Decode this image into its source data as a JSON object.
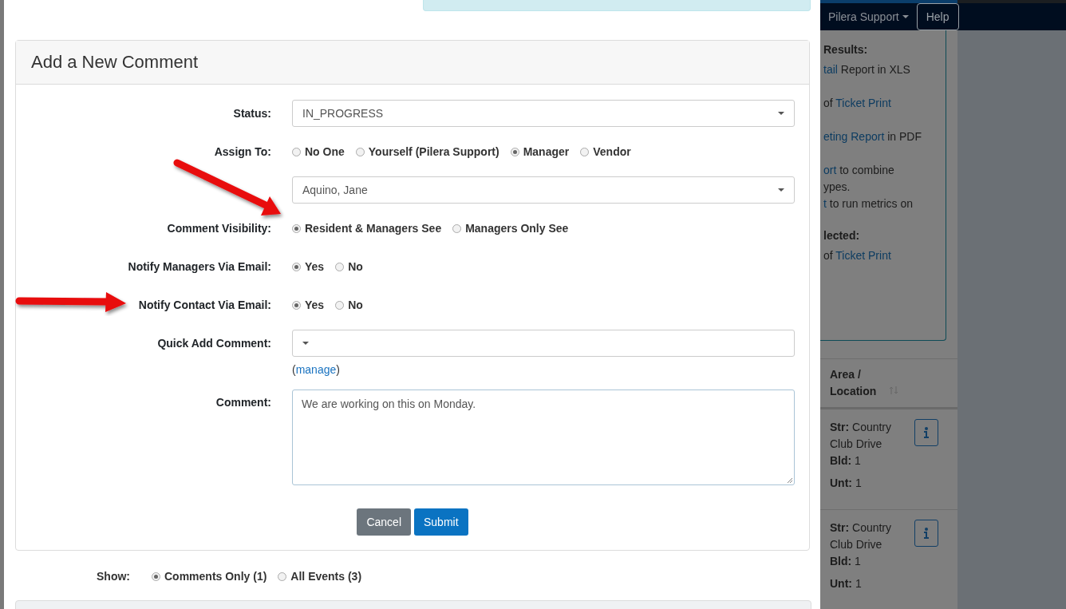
{
  "form": {
    "title": "Add a New Comment",
    "rows": [
      {
        "kind": "select",
        "label": "Status:",
        "value": "IN_PROGRESS"
      },
      {
        "kind": "radio",
        "label": "Assign To:",
        "options": [
          {
            "label": "No One",
            "selected": false
          },
          {
            "label": "Yourself (Pilera Support)",
            "selected": false
          },
          {
            "label": "Manager",
            "selected": true
          },
          {
            "label": "Vendor",
            "selected": false
          }
        ]
      },
      {
        "kind": "select",
        "value": "Aquino, Jane"
      },
      {
        "kind": "radio",
        "label": "Comment Visibility:",
        "options": [
          {
            "label": "Resident & Managers See",
            "selected": true
          },
          {
            "label": "Managers Only See",
            "selected": false
          }
        ]
      },
      {
        "kind": "radio",
        "label": "Notify Managers Via Email:",
        "options": [
          {
            "label": "Yes",
            "selected": true
          },
          {
            "label": "No",
            "selected": false
          }
        ]
      },
      {
        "kind": "radio",
        "label": "Notify Contact Via Email:",
        "options": [
          {
            "label": "Yes",
            "selected": true
          },
          {
            "label": "No",
            "selected": false
          }
        ]
      },
      {
        "kind": "select",
        "label": "Quick Add Comment:",
        "link": {
          "open": "(",
          "text": "manage",
          "close": ")"
        }
      },
      {
        "kind": "textarea",
        "label": "Comment:",
        "value": "We are working on this on Monday."
      }
    ],
    "buttons": [
      {
        "label": "Cancel",
        "kind": "secondary"
      },
      {
        "label": "Submit",
        "kind": "primary"
      }
    ]
  },
  "show": {
    "label": "Show:",
    "options": [
      {
        "label": "Comments Only (1)",
        "selected": true
      },
      {
        "label": "All Events (3)",
        "selected": false
      }
    ]
  },
  "navbar": {
    "user": "Pilera Support",
    "help": "Help"
  },
  "side_panel": {
    "sections": [
      {
        "heading": "Results:",
        "paragraphs": [
          [
            [
              {
                "text": "tail",
                "link": true
              },
              {
                "text": " Report in XLS",
                "link": false
              }
            ]
          ],
          [
            [
              {
                "text": "of ",
                "link": false
              },
              {
                "text": "Ticket Print",
                "link": true
              }
            ]
          ],
          [
            [
              {
                "text": "eting Report",
                "link": true
              },
              {
                "text": " in PDF",
                "link": false
              }
            ]
          ],
          [
            [
              {
                "text": "ort",
                "link": true
              },
              {
                "text": " to combine",
                "link": false
              }
            ],
            [
              {
                "text": "ypes.",
                "link": false
              }
            ],
            [
              {
                "text": "t",
                "link": true
              },
              {
                "text": " to run metrics on",
                "link": false
              }
            ]
          ]
        ]
      },
      {
        "heading": "lected:",
        "paragraphs": [
          [
            [
              {
                "text": "of ",
                "link": false
              },
              {
                "text": "Ticket Print",
                "link": true
              }
            ]
          ]
        ]
      }
    ]
  },
  "table": {
    "header": "Area / Location",
    "rows": [
      {
        "street_label": "Str:",
        "street": "Country Club Drive",
        "building_label": "Bld:",
        "building": "1",
        "unit_label": "Unt:",
        "unit": "1"
      },
      {
        "street_label": "Str:",
        "street": "Country Club Drive",
        "building_label": "Bld:",
        "building": "1",
        "unit_label": "Unt:",
        "unit": "1"
      }
    ]
  }
}
